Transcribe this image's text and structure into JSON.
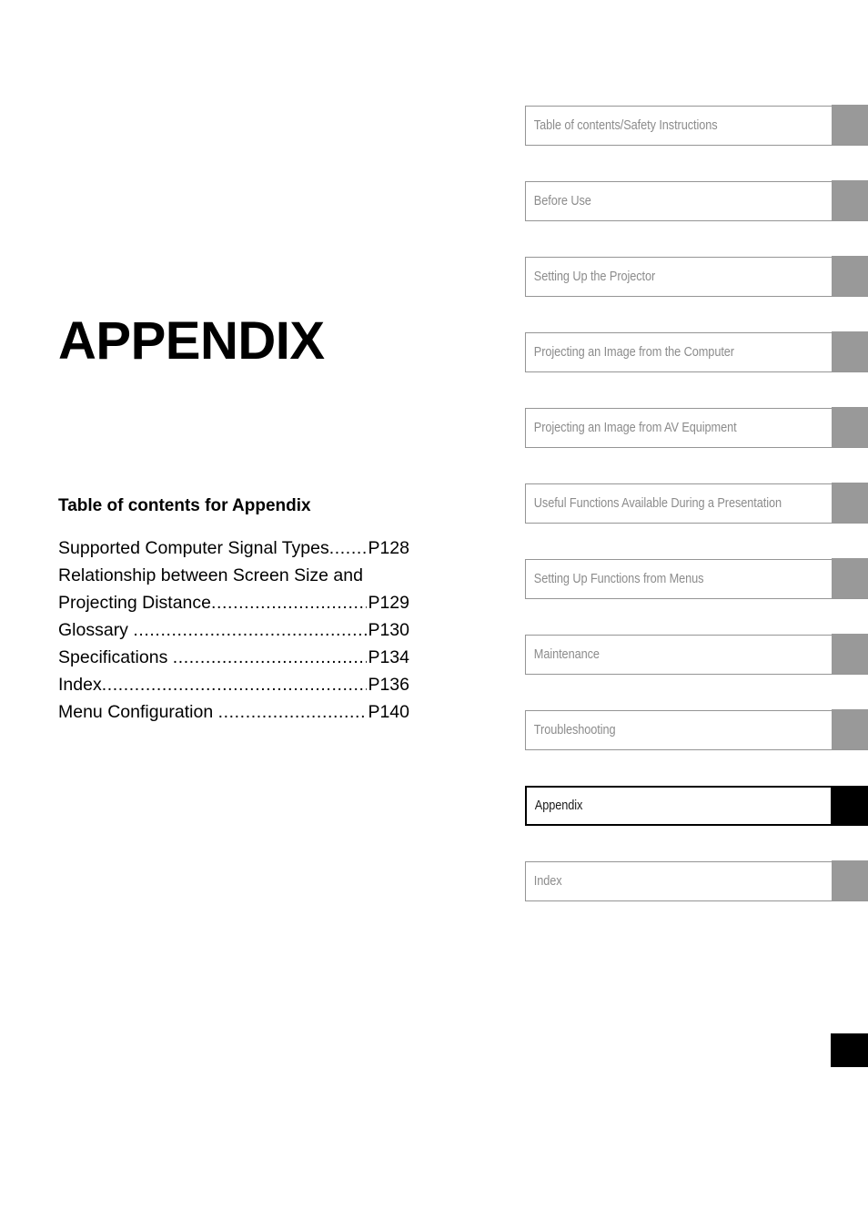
{
  "page": {
    "title": "APPENDIX",
    "background_color": "#ffffff"
  },
  "toc": {
    "heading": "Table of contents for Appendix",
    "entries": [
      {
        "label": "Supported Computer Signal Types",
        "dots": "............",
        "page": "P128",
        "wrapped_first_line": ""
      },
      {
        "label": "Projecting Distance",
        "dots": "...................................",
        "page": "P129",
        "wrapped_first_line": "Relationship between Screen Size and"
      },
      {
        "label": "Glossary ",
        "dots": "..................................................",
        "page": "P130",
        "wrapped_first_line": ""
      },
      {
        "label": "Specifications ",
        "dots": ".........................................",
        "page": "P134",
        "wrapped_first_line": ""
      },
      {
        "label": "Index",
        "dots": ".........................................................",
        "page": "P136",
        "wrapped_first_line": ""
      },
      {
        "label": "Menu Configuration ",
        "dots": "..................................",
        "page": "P140",
        "wrapped_first_line": ""
      }
    ]
  },
  "tab_rail": {
    "active_index": 9,
    "inactive_color": "#999999",
    "active_color": "#000000",
    "inactive_text_color": "#8c8c8c",
    "border_color": "#959595",
    "tabs": [
      {
        "label": "Table of contents/Safety Instructions",
        "active": false
      },
      {
        "label": "Before Use",
        "active": false
      },
      {
        "label": "Setting Up the Projector",
        "active": false
      },
      {
        "label": "Projecting an Image from the Computer",
        "active": false
      },
      {
        "label": "Projecting an Image from AV Equipment",
        "active": false
      },
      {
        "label": "Useful Functions Available During a Presentation",
        "active": false
      },
      {
        "label": "Setting Up Functions from Menus",
        "active": false
      },
      {
        "label": "Maintenance",
        "active": false
      },
      {
        "label": "Troubleshooting",
        "active": false
      },
      {
        "label": "Appendix",
        "active": true
      },
      {
        "label": "Index",
        "active": false
      }
    ]
  },
  "thumb_index": {
    "color": "#000000"
  }
}
